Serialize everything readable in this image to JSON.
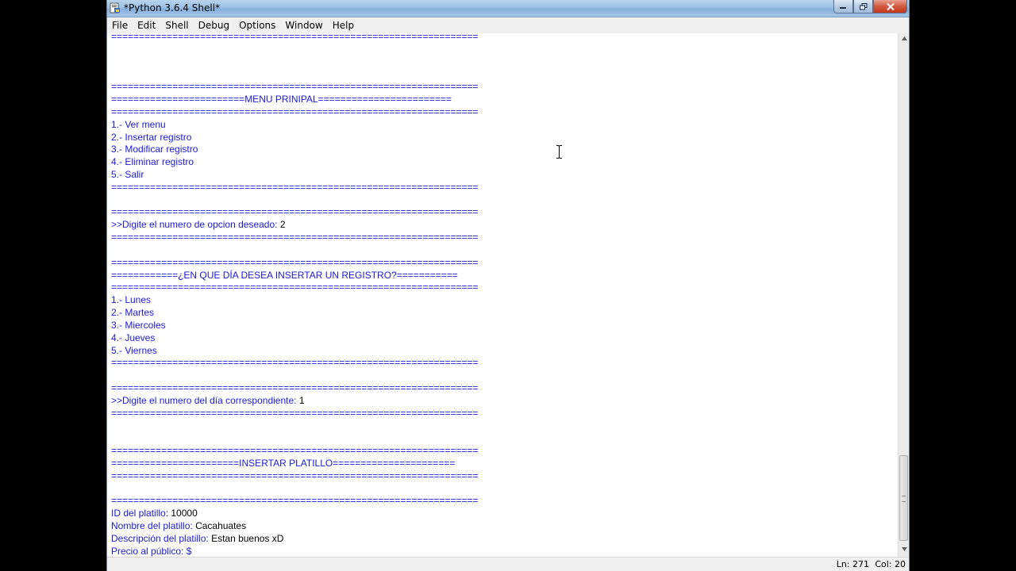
{
  "window": {
    "title": "*Python 3.6.4 Shell*",
    "icon": "python-shell-icon",
    "buttons": {
      "minimize_icon": "minimize-icon",
      "maximize_icon": "restore-icon",
      "close_icon": "close-icon"
    }
  },
  "menubar": {
    "items": [
      "File",
      "Edit",
      "Shell",
      "Debug",
      "Options",
      "Window",
      "Help"
    ]
  },
  "editor": {
    "output_color": "#1a1adc",
    "input_color": "#000000",
    "lines": [
      {
        "text": "=================================================================="
      },
      {
        "text": ""
      },
      {
        "text": ""
      },
      {
        "text": ""
      },
      {
        "text": "=================================================================="
      },
      {
        "text": "========================MENU PRINIPAL========================"
      },
      {
        "text": "=================================================================="
      },
      {
        "text": "1.- Ver menu"
      },
      {
        "text": "2.- Insertar registro"
      },
      {
        "text": "3.- Modificar registro"
      },
      {
        "text": "4.- Eliminar registro"
      },
      {
        "text": "5.- Salir"
      },
      {
        "text": "=================================================================="
      },
      {
        "text": ""
      },
      {
        "text": "=================================================================="
      },
      {
        "text": ">>Digite el numero de opcion deseado: ",
        "input": "2"
      },
      {
        "text": "=================================================================="
      },
      {
        "text": ""
      },
      {
        "text": "=================================================================="
      },
      {
        "text": "============¿EN QUE DÍA DESEA INSERTAR UN REGISTRO?==========="
      },
      {
        "text": "=================================================================="
      },
      {
        "text": "1.- Lunes"
      },
      {
        "text": "2.- Martes"
      },
      {
        "text": "3.- Miercoles"
      },
      {
        "text": "4.- Jueves"
      },
      {
        "text": "5.- Viernes"
      },
      {
        "text": "=================================================================="
      },
      {
        "text": ""
      },
      {
        "text": "=================================================================="
      },
      {
        "text": ">>Digite el numero del día correspondiente: ",
        "input": "1"
      },
      {
        "text": "=================================================================="
      },
      {
        "text": ""
      },
      {
        "text": ""
      },
      {
        "text": "=================================================================="
      },
      {
        "text": "=======================INSERTAR PLATILLO======================"
      },
      {
        "text": "=================================================================="
      },
      {
        "text": ""
      },
      {
        "text": "=================================================================="
      },
      {
        "text": "ID del platillo: ",
        "input": "10000"
      },
      {
        "text": "Nombre del platillo: ",
        "input": "Cacahuates"
      },
      {
        "text": "Descripción del platillo: ",
        "input": "Estan buenos xD"
      },
      {
        "text": "Precio al público: $",
        "input": ""
      }
    ]
  },
  "scrollbar": {
    "up_icon": "scroll-up-arrow-icon",
    "down_icon": "scroll-down-arrow-icon"
  },
  "statusbar": {
    "line": "Ln: 271",
    "column": "Col: 20"
  },
  "cursor": {
    "icon": "text-ibeam-cursor-icon"
  }
}
